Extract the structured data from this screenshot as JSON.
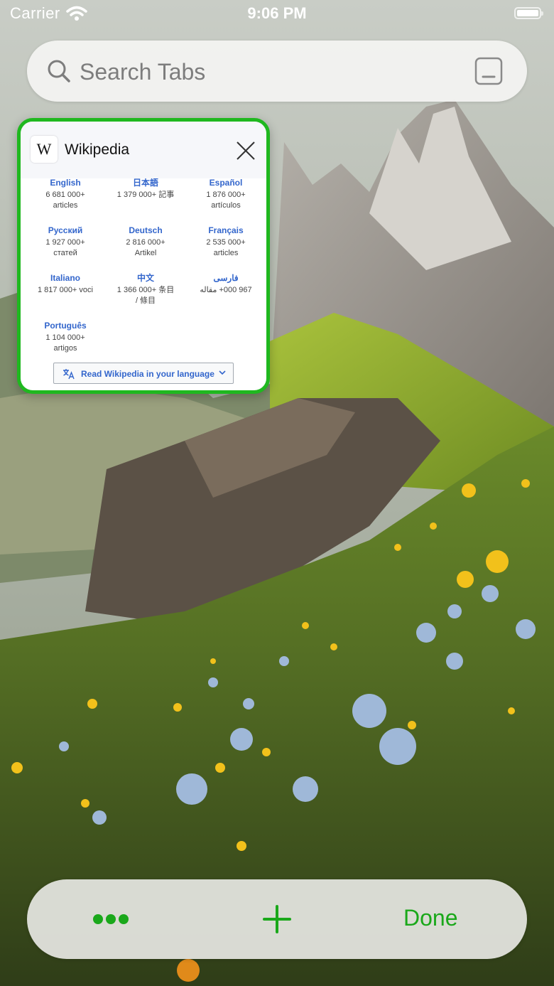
{
  "status_bar": {
    "carrier": "Carrier",
    "time": "9:06 PM"
  },
  "search": {
    "placeholder": "Search Tabs",
    "value": ""
  },
  "tab": {
    "title": "Wikipedia",
    "favicon": "W",
    "languages": [
      {
        "name": "English",
        "count": "6 681 000+",
        "unit": "articles"
      },
      {
        "name": "日本語",
        "count": "1 379 000+ 記事",
        "unit": ""
      },
      {
        "name": "Español",
        "count": "1 876 000+",
        "unit": "artículos"
      },
      {
        "name": "Русский",
        "count": "1 927 000+",
        "unit": "статей"
      },
      {
        "name": "Deutsch",
        "count": "2 816 000+",
        "unit": "Artikel"
      },
      {
        "name": "Français",
        "count": "2 535 000+",
        "unit": "articles"
      },
      {
        "name": "Italiano",
        "count": "1 817 000+ voci",
        "unit": ""
      },
      {
        "name": "中文",
        "count": "1 366 000+ 条目",
        "unit": "/ 條目"
      },
      {
        "name": "فارسی",
        "count": "967 000+ مقاله",
        "unit": ""
      },
      {
        "name": "Português",
        "count": "1 104 000+",
        "unit": "artigos"
      }
    ],
    "language_button_label": "Read Wikipedia in your language"
  },
  "toolbar": {
    "done_label": "Done"
  },
  "colors": {
    "accent": "#1aa81a",
    "selection_border": "#1fb81f",
    "wiki_link": "#3366cc"
  },
  "icons": {
    "search": "magnifier",
    "tab_layout": "tab-layout-icon",
    "close": "close-icon",
    "more": "ellipsis-icon",
    "new_tab": "plus-icon"
  }
}
